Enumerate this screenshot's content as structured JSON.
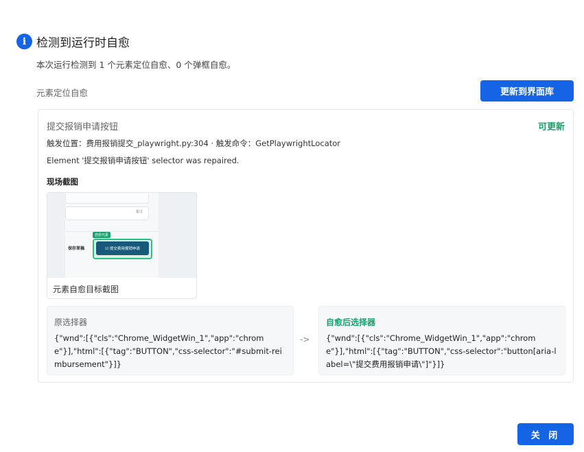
{
  "header": {
    "icon": "info-icon",
    "icon_glyph": "i",
    "title": "检测到运行时自愈",
    "summary": "本次运行检测到 1 个元素定位自愈、0 个弹框自愈。"
  },
  "section": {
    "label": "元素定位自愈",
    "update_button": "更新到界面库"
  },
  "card": {
    "title": "提交报销申请按钮",
    "status": "可更新",
    "trigger": "触发位置：费用报销提交_playwright.py:304 · 触发命令：GetPlaywrightLocator",
    "message": "Element '提交报销申请按钮' selector was repaired.",
    "screenshot_heading": "现场截图",
    "screenshot": {
      "caption": "元素自愈目标截图",
      "note": "备注",
      "save_label": "保存草稿",
      "tag": "自愈元素",
      "button_label": "☑ 提交费用报销申请"
    },
    "original_selector": {
      "label": "原选择器",
      "value": "{\"wnd\":[{\"cls\":\"Chrome_WidgetWin_1\",\"app\":\"chrome\"}],\"html\":[{\"tag\":\"BUTTON\",\"css-selector\":\"#submit-reimbursement\"}]}"
    },
    "arrow": "->",
    "healed_selector": {
      "label": "自愈后选择器",
      "value": "{\"wnd\":[{\"cls\":\"Chrome_WidgetWin_1\",\"app\":\"chrome\"}],\"html\":[{\"tag\":\"BUTTON\",\"css-selector\":\"button[aria-label=\\\"提交费用报销申请\\\"]\"}]}"
    }
  },
  "footer": {
    "close_button": "关 闭"
  },
  "colors": {
    "primary": "#1664e6",
    "success": "#1aa06d"
  }
}
